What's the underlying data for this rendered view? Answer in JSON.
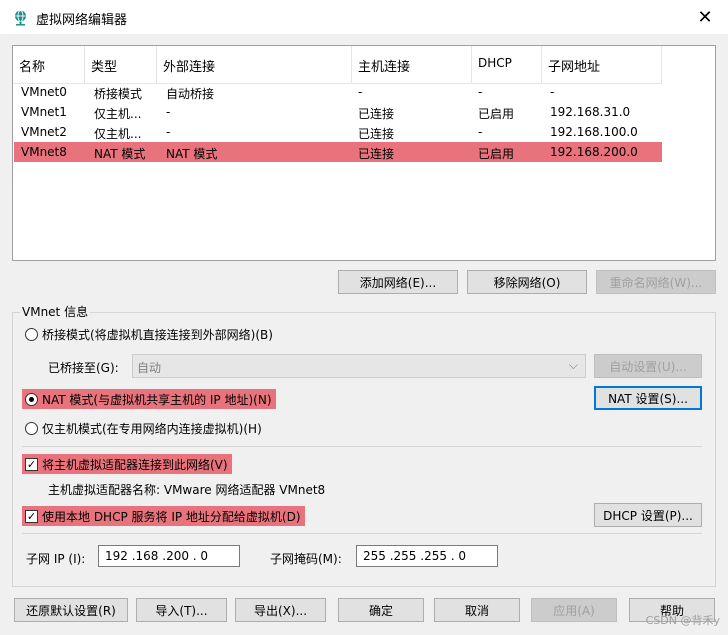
{
  "window": {
    "title": "虚拟网络编辑器",
    "icon": "globe-network-icon",
    "close_glyph": "✕"
  },
  "table": {
    "headers": [
      "名称",
      "类型",
      "外部连接",
      "主机连接",
      "DHCP",
      "子网地址"
    ],
    "rows": [
      {
        "name": "VMnet0",
        "type": "桥接模式",
        "external": "自动桥接",
        "host": "-",
        "dhcp": "-",
        "subnet": "-",
        "selected": false
      },
      {
        "name": "VMnet1",
        "type": "仅主机...",
        "external": "-",
        "host": "已连接",
        "dhcp": "已启用",
        "subnet": "192.168.31.0",
        "selected": false
      },
      {
        "name": "VMnet2",
        "type": "仅主机...",
        "external": "-",
        "host": "已连接",
        "dhcp": "-",
        "subnet": "192.168.100.0",
        "selected": false
      },
      {
        "name": "VMnet8",
        "type": "NAT 模式",
        "external": "NAT 模式",
        "host": "已连接",
        "dhcp": "已启用",
        "subnet": "192.168.200.0",
        "selected": true
      }
    ]
  },
  "table_buttons": {
    "add": "添加网络(E)...",
    "remove": "移除网络(O)",
    "rename": "重命名网络(W)..."
  },
  "vmnet_info": {
    "group_label": "VMnet 信息",
    "bridged_radio": "桥接模式(将虚拟机直接连接到外部网络)(B)",
    "bridged_to_label": "已桥接至(G):",
    "bridged_to_value": "自动",
    "auto_settings": "自动设置(U)...",
    "nat_radio": "NAT 模式(与虚拟机共享主机的 IP 地址)(N)",
    "nat_settings": "NAT 设置(S)...",
    "host_only_radio": "仅主机模式(在专用网络内连接虚拟机)(H)",
    "connect_adapter_check": "将主机虚拟适配器连接到此网络(V)",
    "adapter_name_text": "主机虚拟适配器名称: VMware 网络适配器 VMnet8",
    "dhcp_check": "使用本地 DHCP 服务将 IP 地址分配给虚拟机(D)",
    "dhcp_settings": "DHCP 设置(P)...",
    "subnet_ip_label": "子网 IP (I):",
    "subnet_ip_value": "192 .168 .200 . 0",
    "subnet_mask_label": "子网掩码(M):",
    "subnet_mask_value": "255 .255 .255 . 0",
    "selected_mode": "nat",
    "connect_adapter_checked": true,
    "dhcp_checked": true
  },
  "footer_buttons": {
    "restore": "还原默认设置(R)",
    "import": "导入(T)...",
    "export": "导出(X)...",
    "ok": "确定",
    "cancel": "取消",
    "apply": "应用(A)",
    "help": "帮助"
  },
  "watermark": "CSDN @背禾y",
  "colors": {
    "highlight": "#e8737c",
    "default_button_border": "#0078d7"
  }
}
